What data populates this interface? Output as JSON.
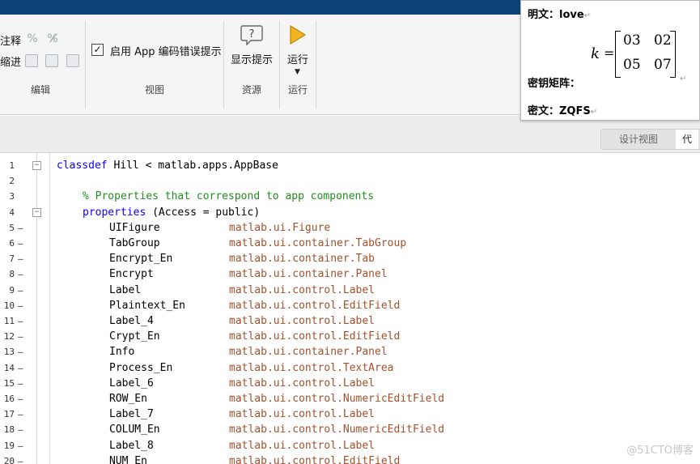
{
  "ribbon": {
    "edit_group": {
      "comment_label": "注释",
      "indent_label": "缩进",
      "group_label": "编辑"
    },
    "view_group": {
      "checkbox_checked": true,
      "checkbox_label": "启用 App 编码错误提示",
      "group_label": "视图"
    },
    "resources_group": {
      "button_label": "显示提示",
      "group_label": "资源"
    },
    "run_group": {
      "button_label": "运行",
      "group_label": "运行"
    }
  },
  "view_tabs": {
    "design": "设计视图",
    "code": "代"
  },
  "overlay": {
    "plaintext": "明文：love",
    "key_label": "密钥矩阵：",
    "ciphertext": "密文：ZQFS",
    "matrix_symbol": "k",
    "matrix_eq": "=",
    "matrix": [
      [
        "03",
        "02"
      ],
      [
        "05",
        "07"
      ]
    ],
    "return_mark": "↵"
  },
  "editor": {
    "lines": [
      {
        "n": "1",
        "text_kw": "classdef",
        "text": " Hill < matlab.apps.AppBase"
      },
      {
        "n": "2",
        "text": ""
      },
      {
        "n": "3",
        "comment": "% Properties that correspond to app components"
      },
      {
        "n": "4",
        "text_kw": "properties",
        "text": " (Access = public)"
      },
      {
        "n": "5",
        "prop": "UIFigure",
        "type": "matlab.ui.Figure"
      },
      {
        "n": "6",
        "prop": "TabGroup",
        "type": "matlab.ui.container.TabGroup"
      },
      {
        "n": "7",
        "prop": "Encrypt_En",
        "type": "matlab.ui.container.Tab"
      },
      {
        "n": "8",
        "prop": "Encrypt",
        "type": "matlab.ui.container.Panel"
      },
      {
        "n": "9",
        "prop": "Label",
        "type": "matlab.ui.control.Label"
      },
      {
        "n": "10",
        "prop": "Plaintext_En",
        "type": "matlab.ui.control.EditField"
      },
      {
        "n": "11",
        "prop": "Label_4",
        "type": "matlab.ui.control.Label"
      },
      {
        "n": "12",
        "prop": "Crypt_En",
        "type": "matlab.ui.control.EditField"
      },
      {
        "n": "13",
        "prop": "Info",
        "type": "matlab.ui.container.Panel"
      },
      {
        "n": "14",
        "prop": "Process_En",
        "type": "matlab.ui.control.TextArea"
      },
      {
        "n": "15",
        "prop": "Label_6",
        "type": "matlab.ui.control.Label"
      },
      {
        "n": "16",
        "prop": "ROW_En",
        "type": "matlab.ui.control.NumericEditField"
      },
      {
        "n": "17",
        "prop": "Label_7",
        "type": "matlab.ui.control.Label"
      },
      {
        "n": "18",
        "prop": "COLUM_En",
        "type": "matlab.ui.control.NumericEditField"
      },
      {
        "n": "19",
        "prop": "Label_8",
        "type": "matlab.ui.control.Label"
      },
      {
        "n": "20",
        "prop": "NUM_En",
        "type": "matlab.ui.control.EditField"
      }
    ]
  },
  "watermark": "@51CTO博客"
}
